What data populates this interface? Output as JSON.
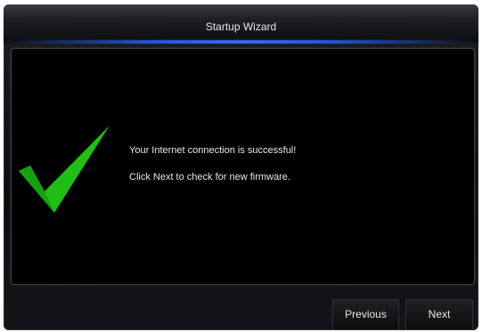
{
  "window": {
    "title": "Startup Wizard"
  },
  "message": {
    "icon": "checkmark-icon",
    "line1": "Your Internet connection is successful!",
    "line2": "Click Next to check for new firmware."
  },
  "buttons": {
    "previous_label": "Previous",
    "next_label": "Next"
  },
  "colors": {
    "accent_glow": "#3c6eff",
    "check_green": "#22c51a"
  }
}
